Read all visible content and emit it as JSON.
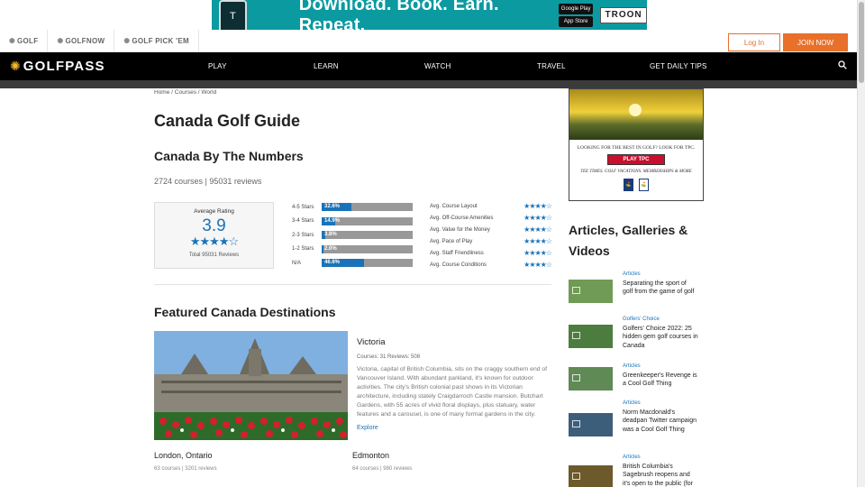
{
  "top_ad": {
    "text": "Download. Book. Earn. Repeat.",
    "google": "Google Play",
    "apple": "App Store",
    "brand": "TROON"
  },
  "network": {
    "links": [
      "GOLF",
      "GOLFNOW",
      "GOLF PICK 'EM"
    ],
    "login": "Log In",
    "join": "JOIN NOW"
  },
  "nav": {
    "logo": "GOLFPASS",
    "items": [
      "PLAY",
      "LEARN",
      "WATCH",
      "TRAVEL",
      "GET DAILY TIPS"
    ]
  },
  "breadcrumb": "Home / Courses / World",
  "page_title": "Canada Golf Guide",
  "numbers": {
    "title": "Canada By The Numbers",
    "counts": "2724 courses | 95031 reviews",
    "average_label": "Average Rating",
    "average_value": "3.9",
    "total_reviews": "Total 95031 Reviews",
    "distribution": [
      {
        "label": "4-5 Stars",
        "pct": "32.6%",
        "value": 32.6
      },
      {
        "label": "3-4 Stars",
        "pct": "14.9%",
        "value": 14.9
      },
      {
        "label": "2-3 Stars",
        "pct": "3.8%",
        "value": 3.8
      },
      {
        "label": "1-2 Stars",
        "pct": "2.0%",
        "value": 2.0
      },
      {
        "label": "N/A",
        "pct": "46.6%",
        "value": 46.6
      }
    ],
    "attributes": [
      {
        "label": "Avg. Course Layout",
        "stars": "★★★★☆"
      },
      {
        "label": "Avg. Off-Course Amenities",
        "stars": "★★★★☆"
      },
      {
        "label": "Avg. Value for the Money",
        "stars": "★★★★☆"
      },
      {
        "label": "Avg. Pace of Play",
        "stars": "★★★★☆"
      },
      {
        "label": "Avg. Staff Friendliness",
        "stars": "★★★★☆"
      },
      {
        "label": "Avg. Course Conditions",
        "stars": "★★★★☆"
      }
    ],
    "average_stars": "★★★★☆"
  },
  "featured": {
    "title": "Featured Canada Destinations",
    "main": {
      "name": "Victoria",
      "meta": "Courses: 31   Reviews: 508",
      "description": "Victoria, capital of British Columbia, sits on the craggy southern end of Vancouver Island. With abundant parkland, it's known for outdoor activities. The city's British colonial past shows in its Victorian architecture, including stately Craigdarroch Castle mansion. Butchart Gardens, with 55 acres of vivid floral displays, plus statuary, water features and a carousel, is one of many formal gardens in the city.",
      "explore": "Explore"
    },
    "others": [
      {
        "name": "London, Ontario",
        "meta": "63 courses | 3201 reviews"
      },
      {
        "name": "Edmonton",
        "meta": "64 courses | 980 reviews"
      }
    ]
  },
  "side_ad": {
    "headline": "LOOKING FOR THE BEST IN GOLF? LOOK FOR TPC.",
    "button": "PLAY TPC",
    "tagline": "TEE TIMES. GOLF VACATIONS. MEMBERSHIPS & MORE"
  },
  "articles": {
    "title": "Articles, Galleries & Videos",
    "items": [
      {
        "category": "Articles",
        "title": "Separating the sport of golf from the game of golf"
      },
      {
        "category": "Golfers' Choice",
        "title": "Golfers' Choice 2022: 25 hidden gem golf courses in Canada"
      },
      {
        "category": "Articles",
        "title": "Greenkeeper's Revenge is a Cool Golf Thing"
      },
      {
        "category": "Articles",
        "title": "Norm Macdonald's deadpan Twitter campaign was a Cool Golf Thing"
      },
      {
        "category": "Articles",
        "title": "British Columbia's Sagebrush reopens and it's open to the public (for"
      }
    ]
  }
}
